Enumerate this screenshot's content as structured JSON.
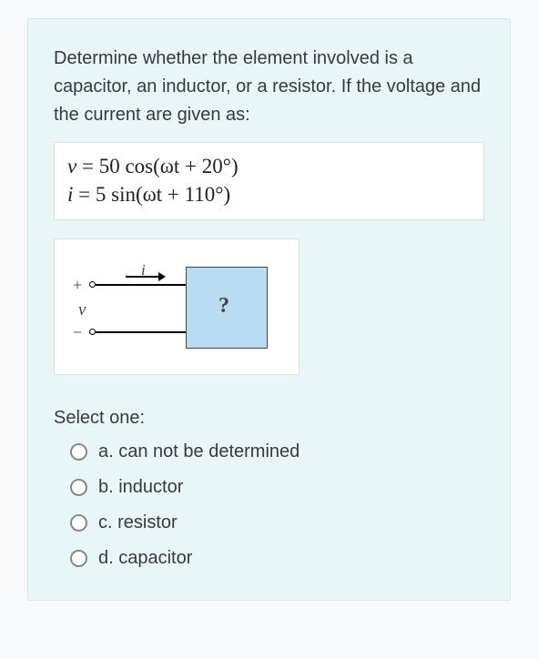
{
  "question": {
    "prompt": "Determine whether the element involved is a capacitor, an inductor, or a resistor. If the voltage and the current are given as:",
    "eq_v_lhs": "v",
    "eq_v_rhs": " = 50 cos(ωt + 20°)",
    "eq_i_lhs": "i",
    "eq_i_rhs": " = 5 sin(ωt + 110°)",
    "select_label": "Select one:",
    "options": [
      {
        "label": "a. can not be determined"
      },
      {
        "label": "b.  inductor"
      },
      {
        "label": "c. resistor"
      },
      {
        "label": "d.  capacitor"
      }
    ]
  },
  "diagram": {
    "plus": "+",
    "minus": "−",
    "v": "v",
    "i": "i",
    "unknown": "?"
  }
}
